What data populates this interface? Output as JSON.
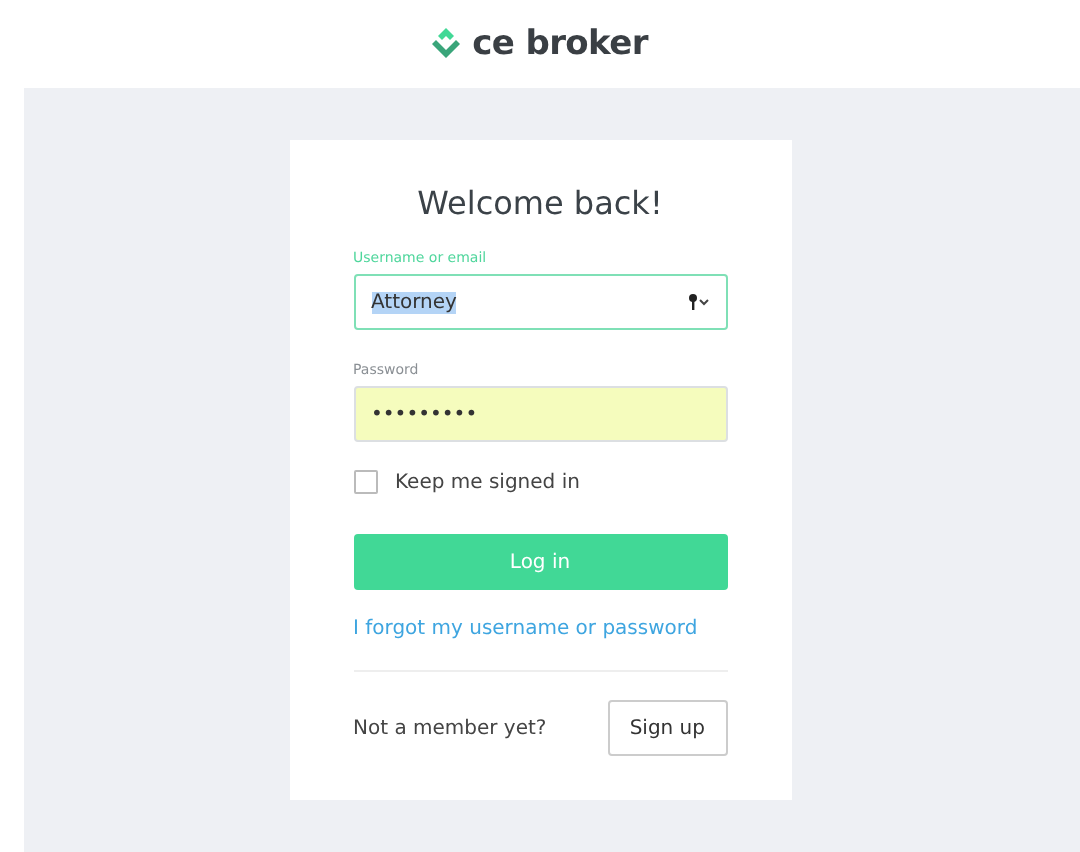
{
  "header": {
    "logo_text": "ce broker"
  },
  "login": {
    "title": "Welcome back!",
    "username": {
      "label": "Username or email",
      "value": "Attorney",
      "focused": true,
      "value_highlighted": true
    },
    "password": {
      "label": "Password",
      "value": "•••••••••",
      "autofilled": true
    },
    "remember": {
      "label": "Keep me signed in",
      "checked": false
    },
    "submit": "Log in",
    "forgot_link": "I forgot my username or password",
    "signup_prompt": "Not a member yet?",
    "signup_button": "Sign up"
  }
}
